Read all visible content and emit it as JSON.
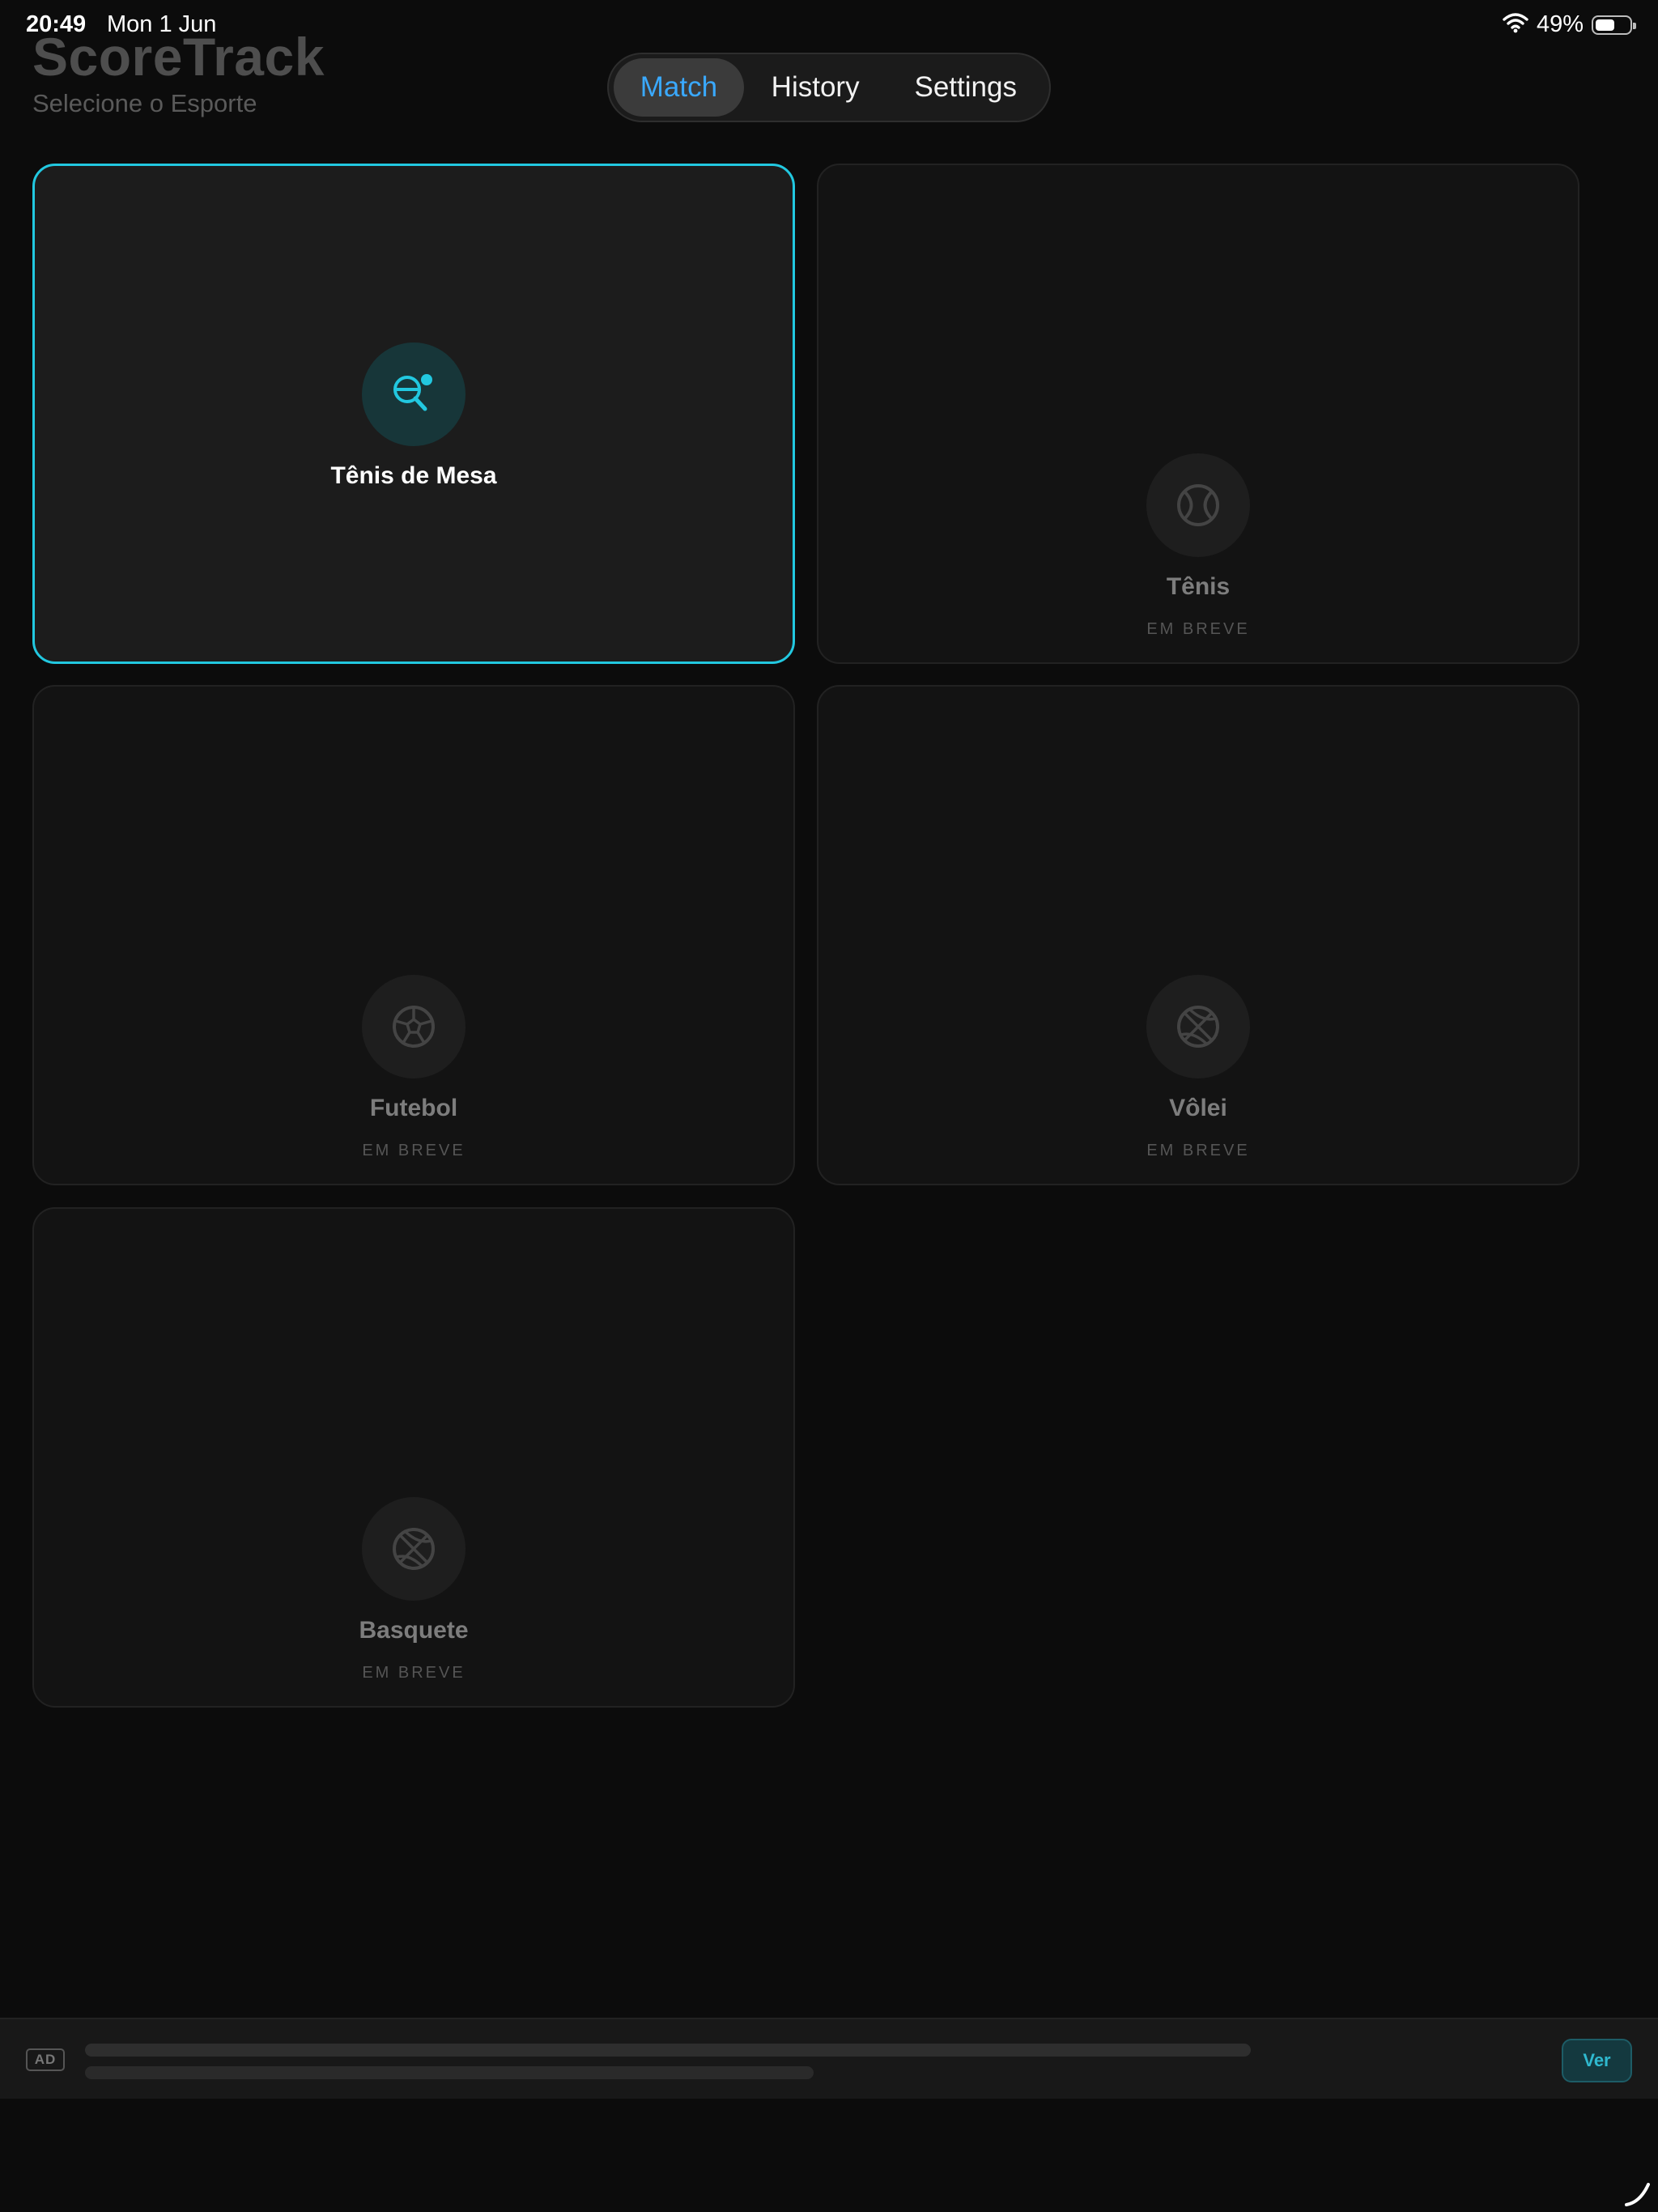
{
  "status_bar": {
    "time": "20:49",
    "date": "Mon 1 Jun",
    "battery_text": "49%",
    "battery_level": 0.49
  },
  "header": {
    "title": "ScoreTrack",
    "subtitle": "Selecione o Esporte"
  },
  "tabs": [
    {
      "label": "Match",
      "selected": true
    },
    {
      "label": "History",
      "selected": false
    },
    {
      "label": "Settings",
      "selected": false
    }
  ],
  "sports": [
    {
      "label": "Tênis de Mesa",
      "icon": "ping-pong-icon",
      "active": true,
      "badge": ""
    },
    {
      "label": "Tênis",
      "icon": "tennis-ball-icon",
      "active": false,
      "badge": "EM BREVE"
    },
    {
      "label": "Futebol",
      "icon": "soccer-ball-icon",
      "active": false,
      "badge": "EM BREVE"
    },
    {
      "label": "Vôlei",
      "icon": "volleyball-icon",
      "active": false,
      "badge": "EM BREVE"
    },
    {
      "label": "Basquete",
      "icon": "basketball-icon",
      "active": false,
      "badge": "EM BREVE"
    }
  ],
  "ad": {
    "tag": "AD",
    "button_label": "Ver"
  },
  "colors": {
    "accent": "#22c8e0",
    "tab_selected_text": "#3aa9ff",
    "background": "#0c0c0c"
  }
}
